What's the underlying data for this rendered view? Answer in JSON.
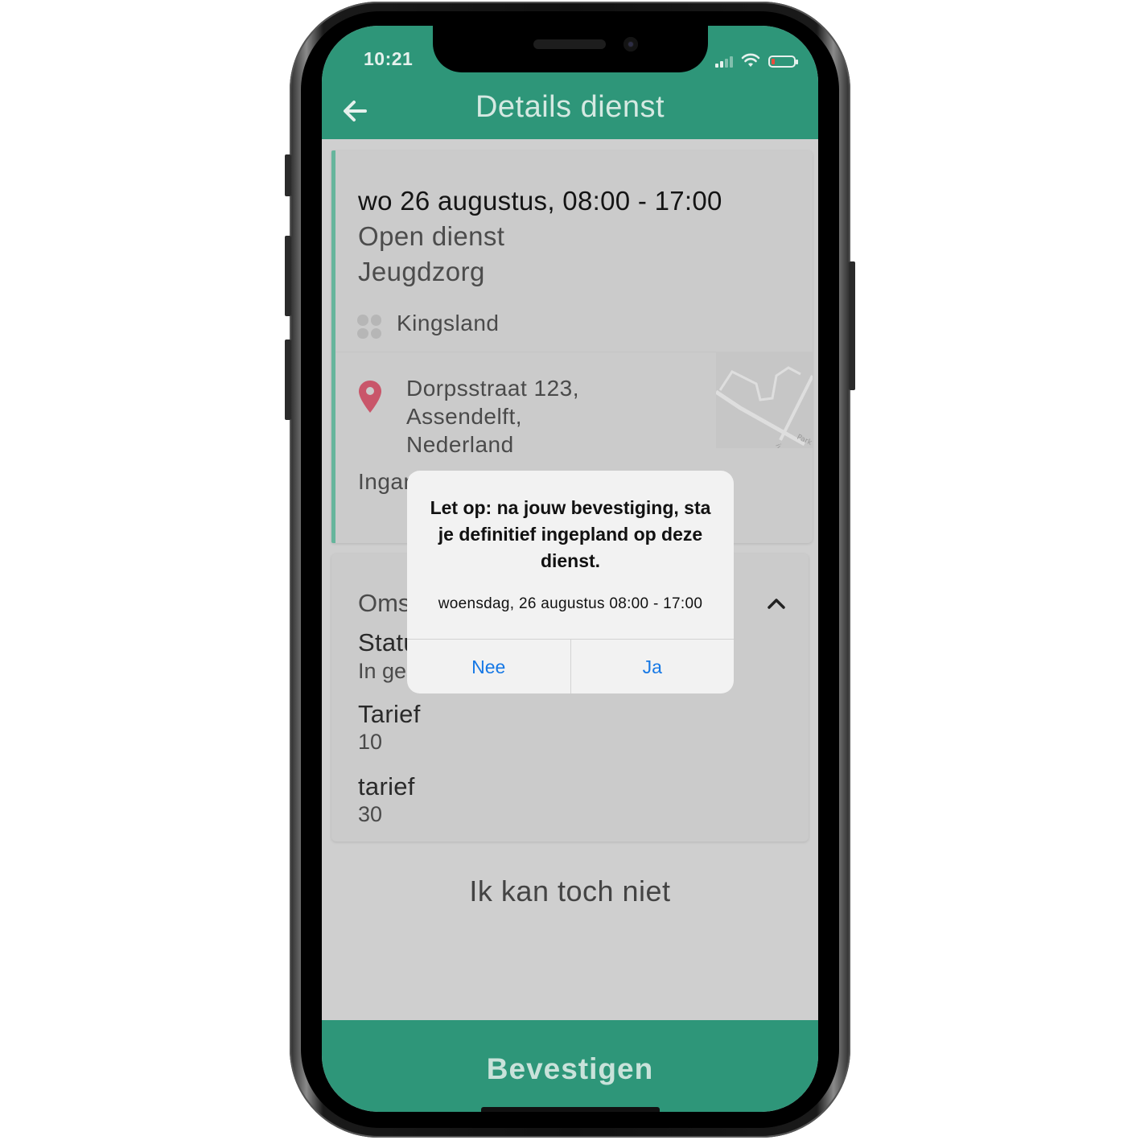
{
  "status_bar": {
    "time": "10:21"
  },
  "header": {
    "title": "Details dienst"
  },
  "shift": {
    "datetime": "wo 26 augustus, 08:00 - 17:00",
    "type": "Open dienst",
    "department": "Jeugdzorg",
    "organization": "Kingsland",
    "address_line1": "Dorpsstraat 123,",
    "address_line2": "Assendelft,",
    "address_line3": "Nederland",
    "entrance_note": "Ingang aan de linkerkant"
  },
  "map_labels": {
    "street1": "Park",
    "street2": "ivd"
  },
  "details": {
    "section_title": "Omschrijving",
    "status_label": "Status",
    "status_value": "In gesprek",
    "rate1_label": "Tarief",
    "rate1_value": "10",
    "rate2_label": "tarief",
    "rate2_value": "30"
  },
  "actions": {
    "cancel_label": "Ik kan toch niet",
    "confirm_label": "Bevestigen"
  },
  "alert": {
    "title": "Let op: na jouw bevestiging, sta je definitief ingepland op deze dienst.",
    "message": "woensdag, 26 augustus 08:00 - 17:00",
    "no_label": "Nee",
    "yes_label": "Ja"
  },
  "colors": {
    "brand_green": "#2e9679",
    "accent_bar": "#66b59c",
    "pin_red": "#c9566a",
    "ios_blue": "#1678e5"
  },
  "icons": [
    "back-arrow-icon",
    "signal-icon",
    "wifi-icon",
    "battery-icon",
    "organization-icon",
    "location-pin-icon",
    "chevron-up-icon"
  ]
}
